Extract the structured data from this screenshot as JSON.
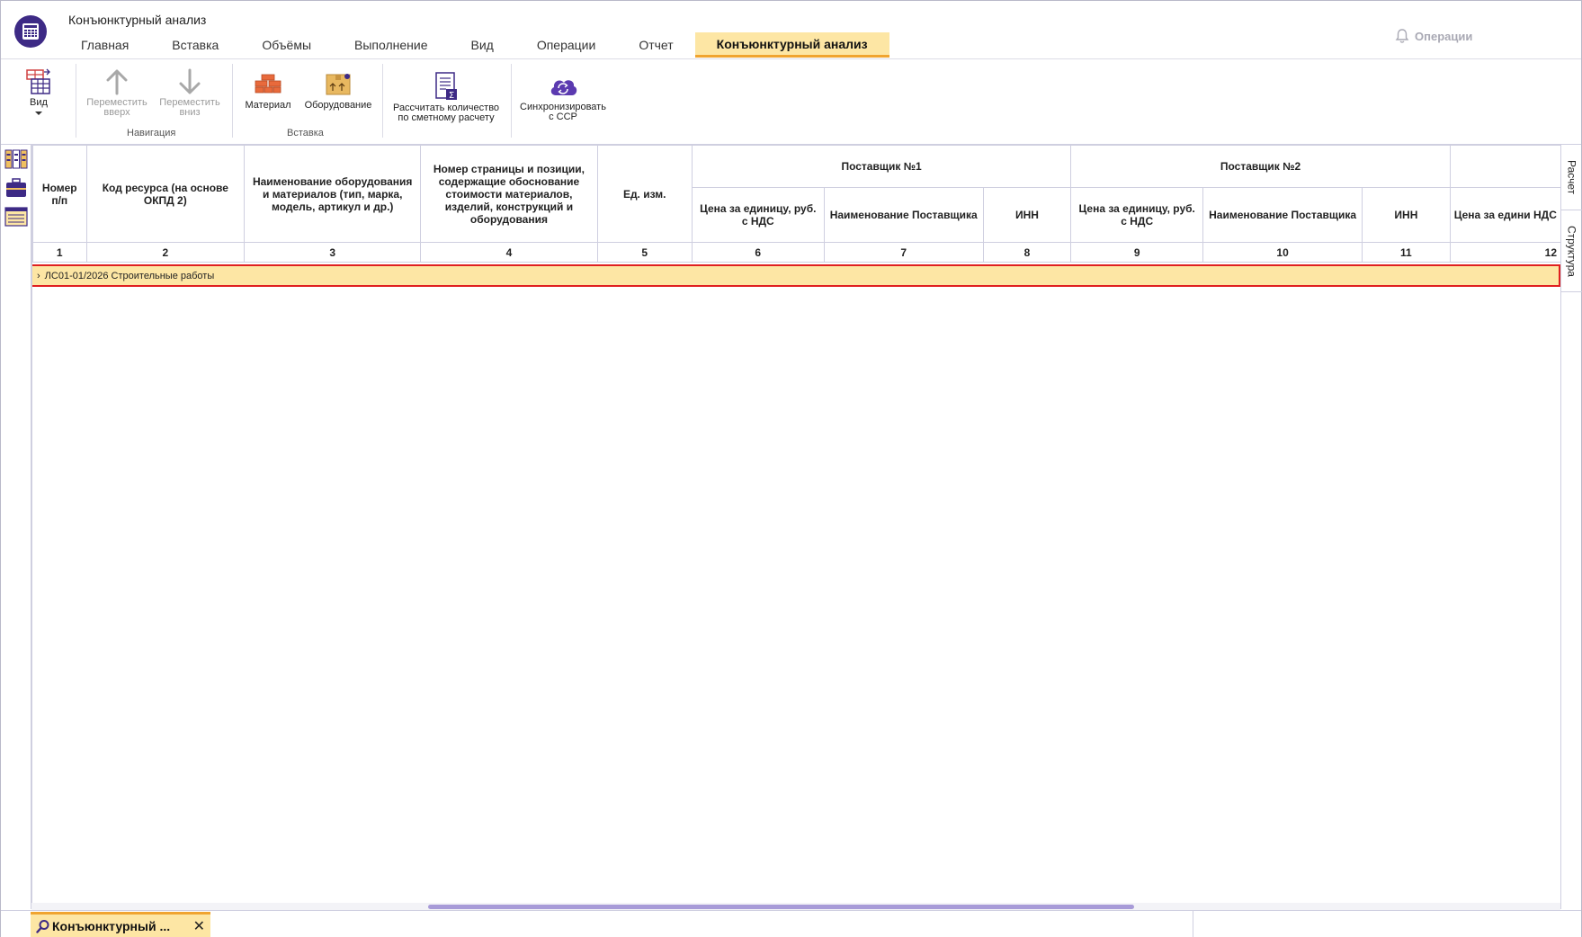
{
  "app": {
    "title": "Конъюнктурный анализ"
  },
  "menu": {
    "tabs": [
      {
        "label": "Главная"
      },
      {
        "label": "Вставка"
      },
      {
        "label": "Объёмы"
      },
      {
        "label": "Выполнение"
      },
      {
        "label": "Вид"
      },
      {
        "label": "Операции"
      },
      {
        "label": "Отчет"
      },
      {
        "label": "Конъюнктурный анализ",
        "active": true
      }
    ],
    "operations_label": "Операции"
  },
  "ribbon": {
    "view_label": "Вид",
    "move_up_label": "Переместить\nвверх",
    "move_down_label": "Переместить\nвниз",
    "navigation_group": "Навигация",
    "material_label": "Материал",
    "equipment_label": "Оборудование",
    "insert_group": "Вставка",
    "calc_label": "Рассчитать количество\nпо сметному расчету",
    "sync_label": "Синхронизировать\nс ССР"
  },
  "side_tabs": {
    "calc": "Расчет",
    "structure": "Структура"
  },
  "table": {
    "headers": {
      "num": "Номер п/п",
      "code": "Код ресурса (на основе ОКПД 2)",
      "name": "Наименование оборудования и материалов (тип, марка, модель, артикул и др.)",
      "page": "Номер страницы и позиции, содержащие обоснование стоимости материалов, изделий, конструкций и оборудования",
      "unit": "Ед. изм.",
      "supplier1": "Поставщик №1",
      "supplier2": "Поставщик №2",
      "price": "Цена за единицу, руб. с НДС",
      "supplier_name": "Наименование Поставщика",
      "inn": "ИНН",
      "price_cut": "Цена за едини НДС"
    },
    "col_numbers": [
      "1",
      "2",
      "3",
      "4",
      "5",
      "6",
      "7",
      "8",
      "9",
      "10",
      "11",
      "12"
    ],
    "group_row": "ЛС01-01/2026 Строительные работы"
  },
  "bottom": {
    "doc_tab": "Конъюнктурный ..."
  },
  "colors": {
    "accent": "#fde6a4",
    "accent_border": "#f0a430",
    "brand": "#3d2a85",
    "highlight": "#e02020",
    "scroll_thumb": "#a89bd8"
  }
}
